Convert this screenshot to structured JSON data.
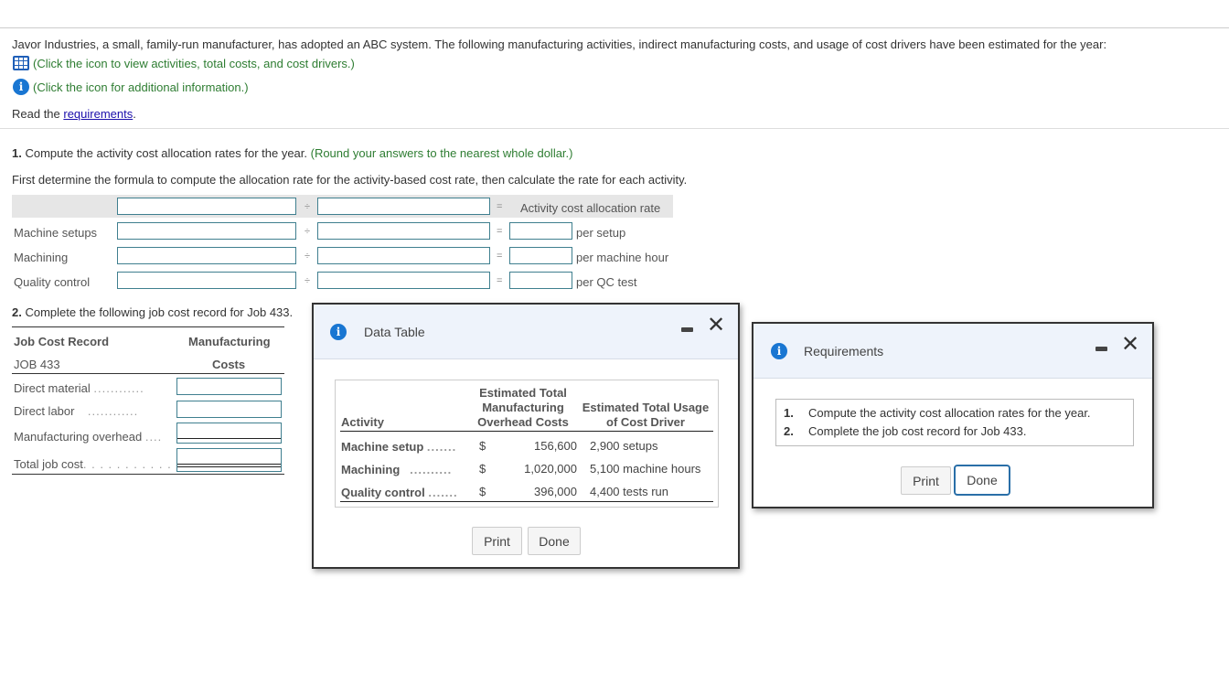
{
  "intro": {
    "text": "Javor Industries, a small, family-run manufacturer, has adopted an ABC system. The following manufacturing activities, indirect manufacturing costs, and usage of cost drivers have been estimated for the year:",
    "data_link": "(Click the icon to view activities, total costs, and cost drivers.)",
    "info_link": "(Click the icon for additional information.)",
    "read_prefix": "Read the ",
    "requirements_link": "requirements",
    "read_suffix": "."
  },
  "part1": {
    "number": "1.",
    "prompt": " Compute the activity cost allocation rates for the year.",
    "hint": " (Round your answers to the nearest whole dollar.)",
    "subprompt": "First determine the formula to compute the allocation rate for the activity-based cost rate, then calculate the rate for each activity.",
    "divide_sign": "÷",
    "equals_sign": "=",
    "header_result": "Activity cost allocation rate",
    "rows": [
      {
        "label": "Machine setups",
        "unit": "per setup",
        "numerator": "",
        "denominator": "",
        "rate": ""
      },
      {
        "label": "Machining",
        "unit": "per machine hour",
        "numerator": "",
        "denominator": "",
        "rate": ""
      },
      {
        "label": "Quality control",
        "unit": "per QC test",
        "numerator": "",
        "denominator": "",
        "rate": ""
      }
    ]
  },
  "part2": {
    "number": "2.",
    "prompt": " Complete the following job cost record for Job 433.",
    "header_left_1": "Job Cost Record",
    "header_left_2": "JOB 433",
    "header_right_1": "Manufacturing",
    "header_right_2": "Costs",
    "rows": [
      {
        "label": "Direct material",
        "dots": "............",
        "value": ""
      },
      {
        "label": "Direct labor",
        "dots": "............",
        "value": ""
      },
      {
        "label": "Manufacturing overhead",
        "dots": "....",
        "value": ""
      },
      {
        "label": "Total job cost",
        "dots": ". . . . . . . . . . . . . .",
        "value": ""
      }
    ]
  },
  "data_table_modal": {
    "title": "Data Table",
    "col_activity": "Activity",
    "col_costs_1": "Estimated Total",
    "col_costs_2": "Manufacturing",
    "col_costs_3": "Overhead Costs",
    "col_usage_1": "Estimated Total Usage",
    "col_usage_2": "of Cost Driver",
    "currency": "$",
    "rows": [
      {
        "activity": "Machine setup",
        "dots": ".......",
        "cost": "156,600",
        "usage": "2,900 setups"
      },
      {
        "activity": "Machining",
        "dots": "..........",
        "cost": "1,020,000",
        "usage": "5,100 machine hours"
      },
      {
        "activity": "Quality control",
        "dots": ".......",
        "cost": "396,000",
        "usage": "4,400 tests run"
      }
    ],
    "print_label": "Print",
    "done_label": "Done"
  },
  "requirements_modal": {
    "title": "Requirements",
    "items": [
      {
        "num": "1.",
        "text": "Compute the activity cost allocation rates for the year."
      },
      {
        "num": "2.",
        "text": "Complete the job cost record for Job 433."
      }
    ],
    "print_label": "Print",
    "done_label": "Done"
  }
}
